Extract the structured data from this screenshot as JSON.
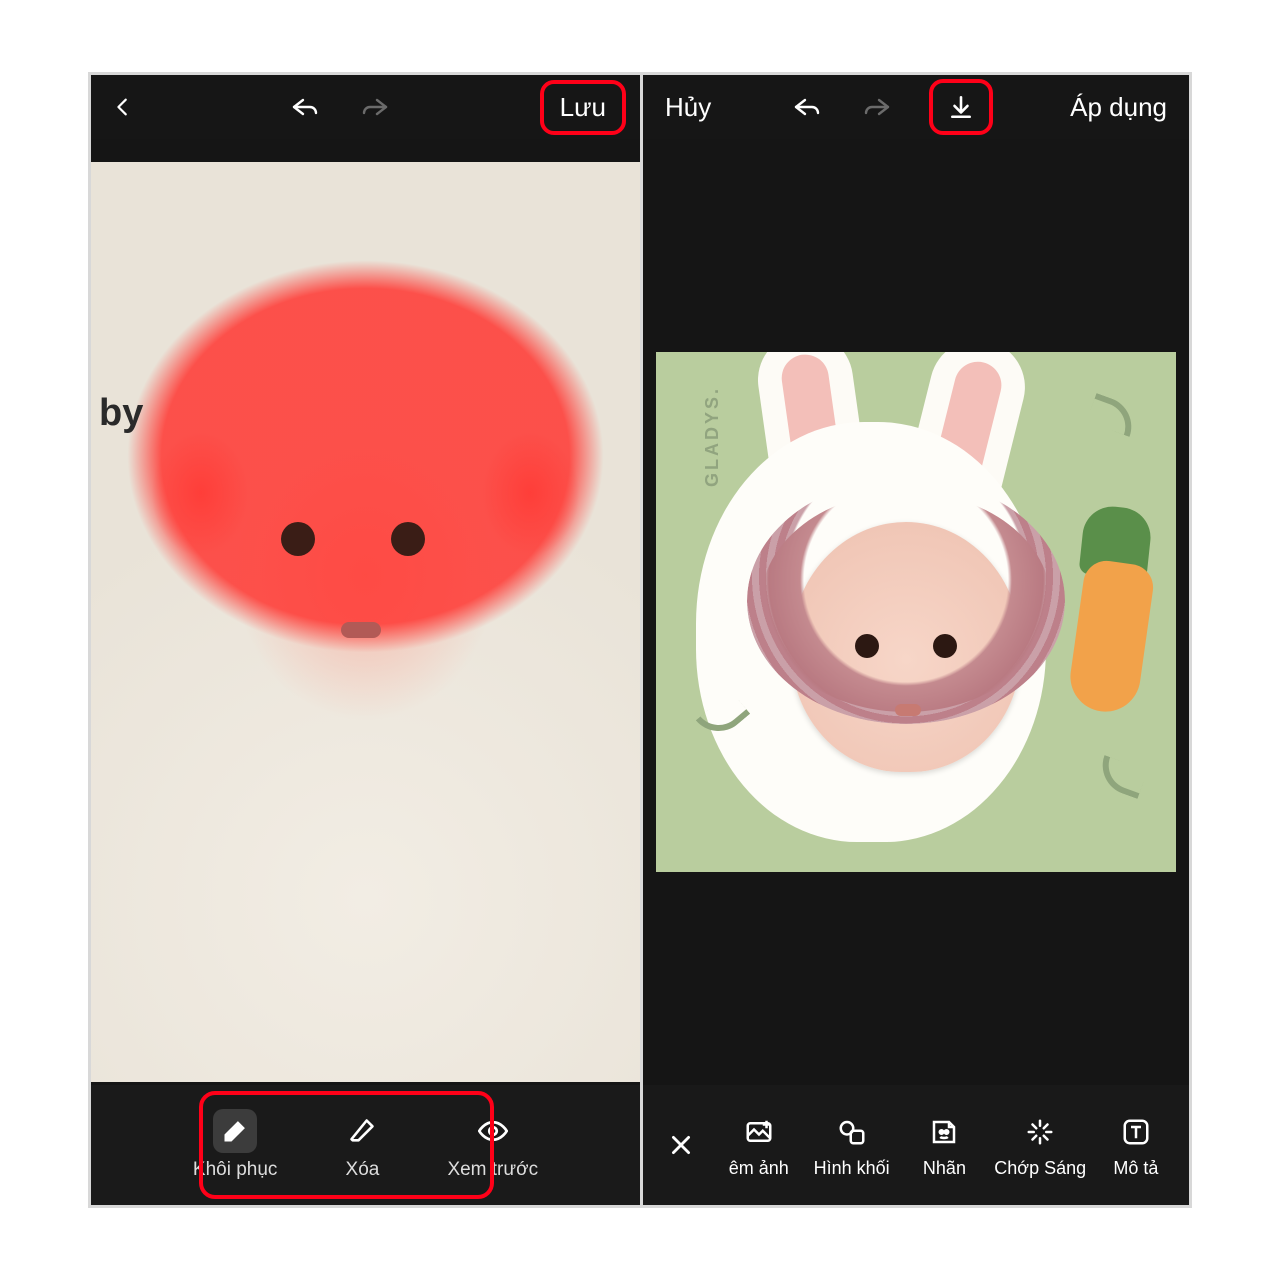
{
  "left": {
    "topbar": {
      "save_label": "Lưu"
    },
    "badge_text": "by",
    "tools": {
      "restore": "Khôi phục",
      "erase": "Xóa",
      "preview": "Xem trước"
    }
  },
  "right": {
    "topbar": {
      "cancel_label": "Hủy",
      "apply_label": "Áp dụng"
    },
    "artwork_label": "GLADYS.",
    "tools": {
      "close": "",
      "image": "êm ảnh",
      "shape": "Hình khối",
      "sticker": "Nhãn",
      "flash": "Chớp Sáng",
      "text": "Mô tả"
    }
  }
}
